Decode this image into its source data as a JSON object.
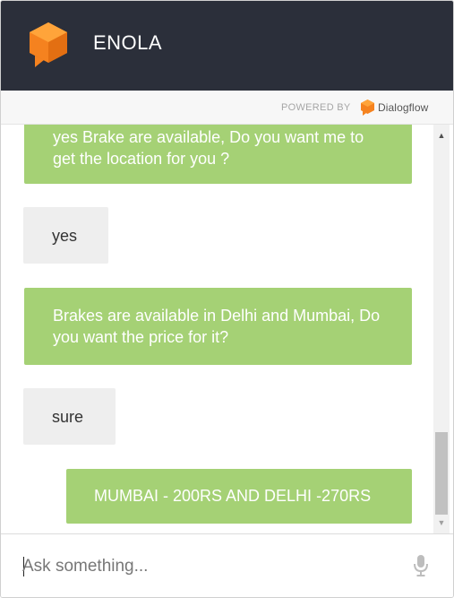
{
  "header": {
    "agent_name": "ENOLA",
    "logo_icon": "agent-cube-icon",
    "background": "#2b2f3a"
  },
  "powered_by": {
    "label": "POWERED BY",
    "brand": "Dialogflow",
    "brand_icon": "dialogflow-icon"
  },
  "messages": [
    {
      "sender": "bot",
      "text": "yes Brake are available, Do you want me to get the location for you ?"
    },
    {
      "sender": "user",
      "text": "yes"
    },
    {
      "sender": "bot",
      "text": "Brakes are available in Delhi and Mumbai, Do you want the price for it?"
    },
    {
      "sender": "user",
      "text": "sure"
    },
    {
      "sender": "bot",
      "text": "MUMBAI - 200RS AND DELHI -270RS"
    }
  ],
  "input": {
    "placeholder": "Ask something...",
    "value": "",
    "mic_icon": "microphone-icon"
  },
  "colors": {
    "bot_bubble": "#a5d175",
    "user_bubble": "#eeeeee",
    "accent_orange": "#f5821f"
  }
}
